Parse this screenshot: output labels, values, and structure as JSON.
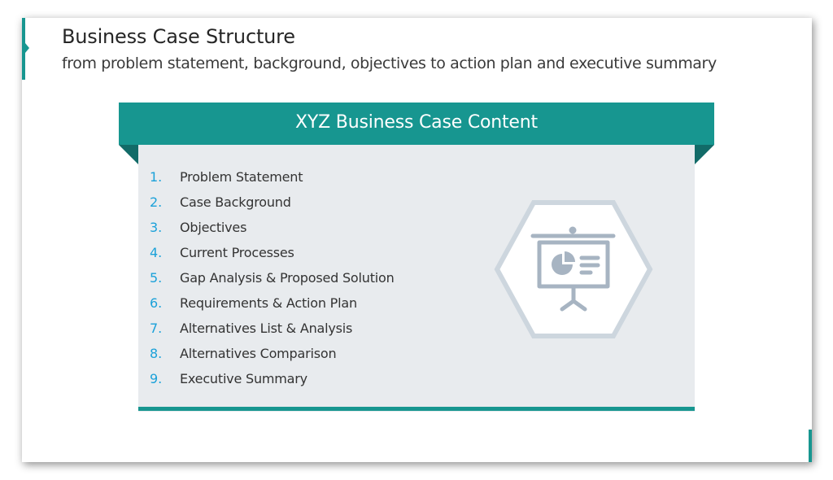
{
  "slide": {
    "title": "Business Case Structure",
    "subtitle": "from problem statement, background, objectives to action plan and executive summary"
  },
  "card": {
    "heading": "XYZ Business Case Content",
    "items": [
      {
        "number": "1.",
        "label": "Problem Statement"
      },
      {
        "number": "2.",
        "label": "Case Background"
      },
      {
        "number": "3.",
        "label": "Objectives"
      },
      {
        "number": "4.",
        "label": "Current Processes"
      },
      {
        "number": "5.",
        "label": "Gap Analysis & Proposed Solution"
      },
      {
        "number": "6.",
        "label": "Requirements & Action Plan"
      },
      {
        "number": "7.",
        "label": "Alternatives List & Analysis"
      },
      {
        "number": "8.",
        "label": "Alternatives Comparison"
      },
      {
        "number": "9.",
        "label": "Executive Summary"
      }
    ],
    "icon": "presentation-board-icon"
  },
  "colors": {
    "accent": "#179690",
    "accent_dark": "#126b68",
    "number": "#1ba1d9",
    "card_bg": "#e8ebee",
    "icon": "#a7b4c2"
  }
}
